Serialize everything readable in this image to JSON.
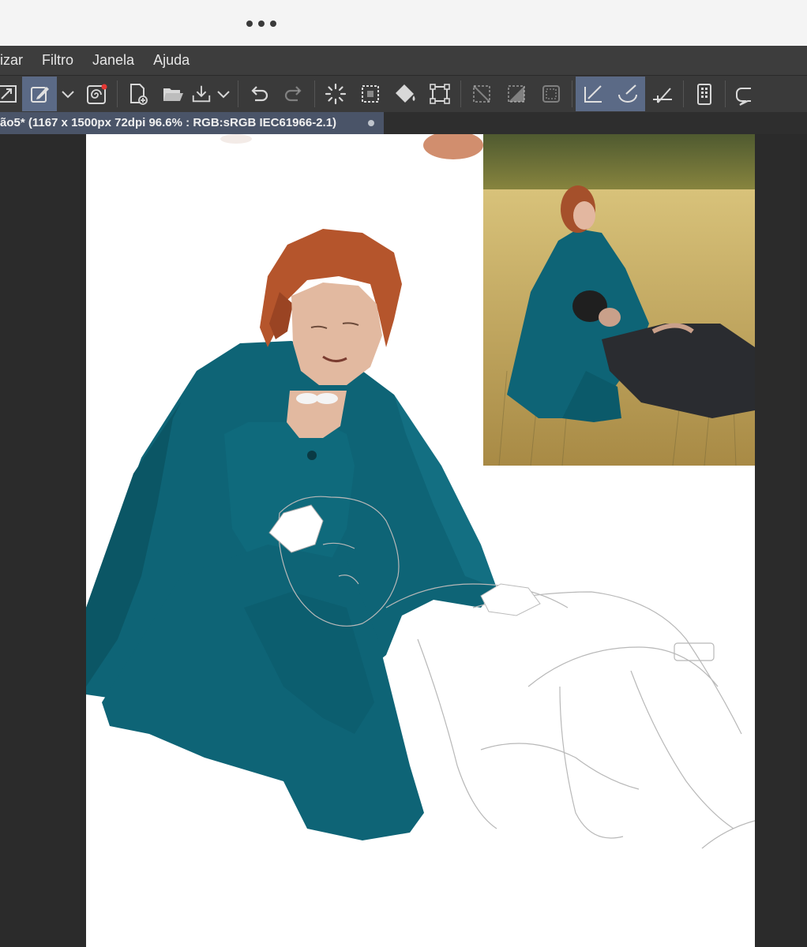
{
  "system": {
    "more_icon": "more-horizontal-icon"
  },
  "menu": {
    "items": [
      "izar",
      "Filtro",
      "Janela",
      "Ajuda"
    ]
  },
  "toolbar": {
    "icons": [
      "resize-icon",
      "edit-icon",
      "chevron-down-icon",
      "spiral-icon",
      "new-file-icon",
      "open-folder-icon",
      "export-icon",
      "chevron-down-icon",
      "undo-icon",
      "redo-icon",
      "spinner-icon",
      "select-all-icon",
      "fill-icon",
      "transform-icon",
      "deselect-icon",
      "invert-selection-icon",
      "selection-border-icon",
      "ruler-snap-icon",
      "brush-snap-icon",
      "guide-snap-icon",
      "tablet-icon",
      "speech-bubble-icon"
    ],
    "colors": {
      "selected": "#5b6a86",
      "bar": "#3a3a3a",
      "notification": "#e53935"
    }
  },
  "document": {
    "tab_title": "ão5* (1167 x 1500px 72dpi 96.6% : RGB:sRGB IEC61966-2.1)"
  },
  "artwork": {
    "cloak_color": "#0e6476",
    "hair_color": "#b5552c",
    "skin_color": "#e2b9a0"
  }
}
